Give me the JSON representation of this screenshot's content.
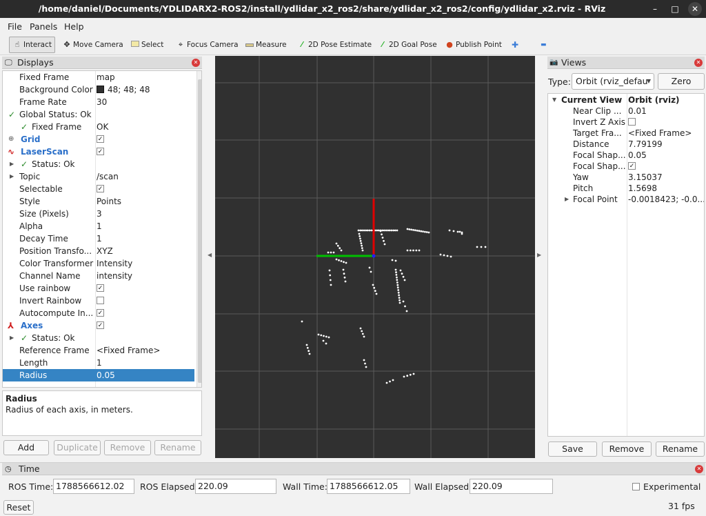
{
  "window": {
    "title": "/home/daniel/Documents/YDLIDARX2-ROS2/install/ydlidar_x2_ros2/share/ydlidar_x2_ros2/config/ydlidar_x2.rviz - RViz",
    "min": "–",
    "max": "□",
    "close": "✕"
  },
  "menus": [
    "File",
    "Panels",
    "Help"
  ],
  "toolbar": {
    "interact": "Interact",
    "move_camera": "Move Camera",
    "select": "Select",
    "focus_camera": "Focus Camera",
    "measure": "Measure",
    "pose_estimate": "2D Pose Estimate",
    "goal_pose": "2D Goal Pose",
    "publish_point": "Publish Point",
    "plus": "✚",
    "minus": "▬"
  },
  "displays": {
    "title": "Displays",
    "rows": [
      {
        "label": "Fixed Frame",
        "value": "map"
      },
      {
        "label": "Background Color",
        "value": "48; 48; 48"
      },
      {
        "label": "Frame Rate",
        "value": "30"
      },
      {
        "label": "Global Status: Ok",
        "value": ""
      },
      {
        "label": "Fixed Frame",
        "value": "OK"
      },
      {
        "label": "Grid",
        "value": ""
      },
      {
        "label": "LaserScan",
        "value": ""
      },
      {
        "label": "Status: Ok",
        "value": ""
      },
      {
        "label": "Topic",
        "value": "/scan"
      },
      {
        "label": "Selectable",
        "value": ""
      },
      {
        "label": "Style",
        "value": "Points"
      },
      {
        "label": "Size (Pixels)",
        "value": "3"
      },
      {
        "label": "Alpha",
        "value": "1"
      },
      {
        "label": "Decay Time",
        "value": "1"
      },
      {
        "label": "Position Transfo...",
        "value": "XYZ"
      },
      {
        "label": "Color Transformer",
        "value": "Intensity"
      },
      {
        "label": "Channel Name",
        "value": "intensity"
      },
      {
        "label": "Use rainbow",
        "value": ""
      },
      {
        "label": "Invert Rainbow",
        "value": ""
      },
      {
        "label": "Autocompute In...",
        "value": ""
      },
      {
        "label": "Axes",
        "value": ""
      },
      {
        "label": "Status: Ok",
        "value": ""
      },
      {
        "label": "Reference Frame",
        "value": "<Fixed Frame>"
      },
      {
        "label": "Length",
        "value": "1"
      },
      {
        "label": "Radius",
        "value": "0.05"
      }
    ],
    "description_title": "Radius",
    "description_text": "Radius of each axis, in meters.",
    "buttons": {
      "add": "Add",
      "duplicate": "Duplicate",
      "remove": "Remove",
      "rename": "Rename"
    },
    "background_color_hex": "#303030"
  },
  "views": {
    "title": "Views",
    "type_label": "Type:",
    "type_value": "Orbit (rviz_defau",
    "zero_button": "Zero",
    "rows": [
      {
        "label": "Current View",
        "value": "Orbit (rviz)"
      },
      {
        "label": "Near Clip ...",
        "value": "0.01"
      },
      {
        "label": "Invert Z Axis",
        "value": ""
      },
      {
        "label": "Target Fra...",
        "value": "<Fixed Frame>"
      },
      {
        "label": "Distance",
        "value": "7.79199"
      },
      {
        "label": "Focal Shap...",
        "value": "0.05"
      },
      {
        "label": "Focal Shap...",
        "value": ""
      },
      {
        "label": "Yaw",
        "value": "3.15037"
      },
      {
        "label": "Pitch",
        "value": "1.5698"
      },
      {
        "label": "Focal Point",
        "value": "-0.0018423; -0.0..."
      }
    ],
    "buttons": {
      "save": "Save",
      "remove": "Remove",
      "rename": "Rename"
    }
  },
  "time": {
    "title": "Time",
    "ros_time_label": "ROS Time:",
    "ros_time": "1788566612.02",
    "ros_elapsed_label": "ROS Elapsed:",
    "ros_elapsed": "220.09",
    "wall_time_label": "Wall Time:",
    "wall_time": "1788566612.05",
    "wall_elapsed_label": "Wall Elapsed:",
    "wall_elapsed": "220.09",
    "experimental_label": "Experimental",
    "reset_button": "Reset",
    "fps": "31 fps"
  },
  "colors": {
    "selection": "#3584c4",
    "axis_x": "#e00000",
    "axis_y": "#00c000",
    "grid": "#5a5a5a",
    "laser": "#ffffff"
  }
}
